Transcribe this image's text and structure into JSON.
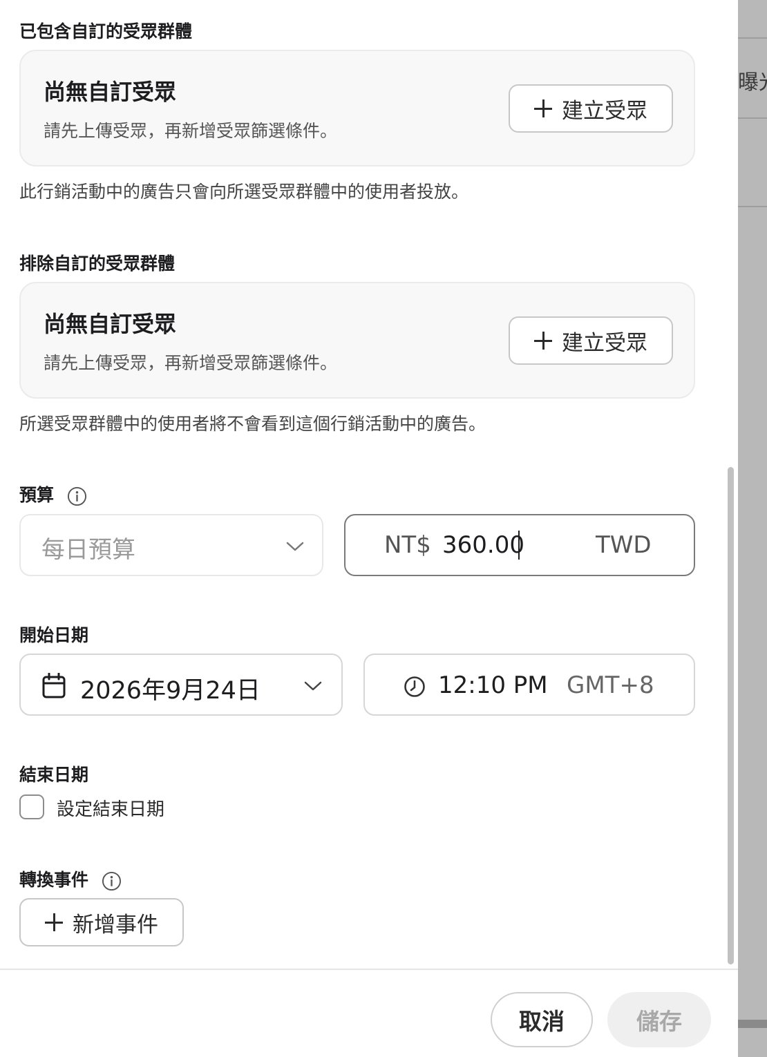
{
  "background": {
    "partial_text": "曝光"
  },
  "include_audience": {
    "label": "已包含自訂的受眾群體",
    "card_title": "尚無自訂受眾",
    "card_desc": "請先上傳受眾，再新增受眾篩選條件。",
    "button_label": "建立受眾",
    "helper": "此行銷活動中的廣告只會向所選受眾群體中的使用者投放。"
  },
  "exclude_audience": {
    "label": "排除自訂的受眾群體",
    "card_title": "尚無自訂受眾",
    "card_desc": "請先上傳受眾，再新增受眾篩選條件。",
    "button_label": "建立受眾",
    "helper": "所選受眾群體中的使用者將不會看到這個行銷活動中的廣告。"
  },
  "budget": {
    "label": "預算",
    "type_selected": "每日預算",
    "currency_prefix": "NT$",
    "amount": "360.00",
    "currency_code": "TWD"
  },
  "start_date": {
    "label": "開始日期",
    "date": "2026年9月24日",
    "time": "12:10 PM",
    "timezone": "GMT+8"
  },
  "end_date": {
    "label": "結束日期",
    "checkbox_label": "設定結束日期",
    "checked": false
  },
  "conversion": {
    "label": "轉換事件",
    "add_button_label": "新增事件"
  },
  "footer": {
    "cancel_label": "取消",
    "save_label": "儲存"
  }
}
